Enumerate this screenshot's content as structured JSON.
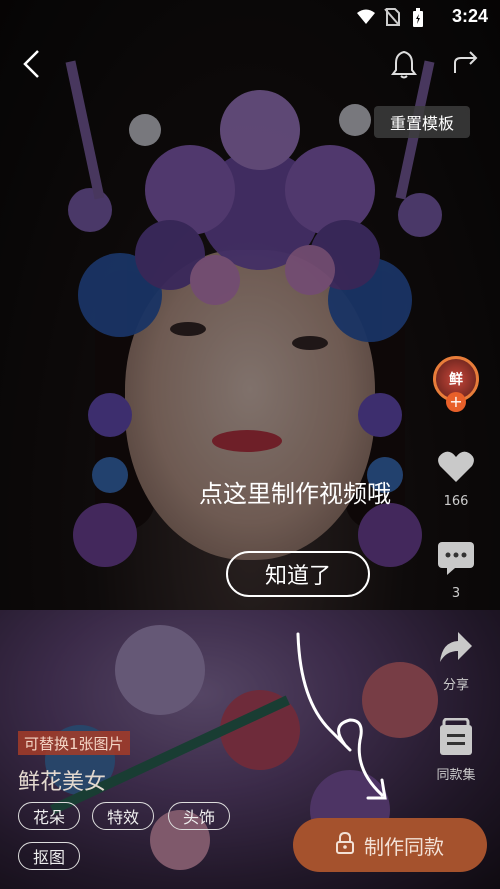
{
  "status_bar": {
    "time": "3:24",
    "icons": [
      "wifi-icon",
      "no-sim-icon",
      "battery-icon"
    ]
  },
  "top_bar": {
    "back_icon": "chevron-left-icon",
    "bell_icon": "bell-icon",
    "share_icon": "share-icon",
    "reset_template_label": "重置模板"
  },
  "right_rail": {
    "author_avatar_text": "鲜",
    "follow_label": "+",
    "like_count": "166",
    "comment_count": "3",
    "share_label": "分享",
    "same_collection_label": "同款集"
  },
  "hint": {
    "text": "点这里制作视频哦",
    "button_label": "知道了"
  },
  "info": {
    "replace_badge": "可替换1张图片",
    "title": "鲜花美女",
    "tags": [
      "花朵",
      "特效",
      "头饰",
      "抠图"
    ]
  },
  "make_button": {
    "label": "制作同款",
    "icon": "lock-icon"
  },
  "colors": {
    "accent": "#a5522d",
    "badge_bg": "#a53c28",
    "avatar_ring": "#e87d3a"
  }
}
